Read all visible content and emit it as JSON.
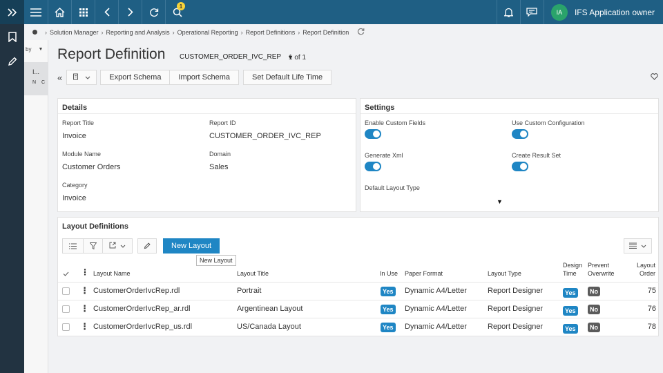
{
  "topbar": {
    "notification_count": "1",
    "user_initials": "IA",
    "user_name": "IFS Application owner",
    "icons": [
      "expand-icon",
      "menu-icon",
      "home-icon",
      "apps-icon",
      "back-icon",
      "forward-icon",
      "refresh-icon",
      "search-icon",
      "bell-icon",
      "chat-icon"
    ]
  },
  "breadcrumb": [
    "Solution Manager",
    "Reporting and Analysis",
    "Operational Reporting",
    "Report Definitions",
    "Report Definition"
  ],
  "list_panel": {
    "sort_label": "by",
    "item_line1": "I...",
    "item_line2": "N C"
  },
  "page": {
    "title": "Report Definition",
    "record_selector": "CUSTOMER_ORDER_IVC_REP",
    "record_count": "1 of 1"
  },
  "commands": {
    "export": "Export Schema",
    "import": "Import Schema",
    "default_life": "Set Default Life Time"
  },
  "details": {
    "title": "Details",
    "report_title_label": "Report Title",
    "report_title_value": "Invoice",
    "report_id_label": "Report ID",
    "report_id_value": "CUSTOMER_ORDER_IVC_REP",
    "module_label": "Module Name",
    "module_value": "Customer Orders",
    "domain_label": "Domain",
    "domain_value": "Sales",
    "category_label": "Category",
    "category_value": "Invoice"
  },
  "settings": {
    "title": "Settings",
    "custom_fields_label": "Enable Custom Fields",
    "custom_fields_on": true,
    "custom_config_label": "Use Custom Configuration",
    "custom_config_on": true,
    "gen_xml_label": "Generate Xml",
    "gen_xml_on": true,
    "result_set_label": "Create Result Set",
    "result_set_on": true,
    "default_layout_label": "Default Layout Type"
  },
  "layouts": {
    "title": "Layout Definitions",
    "new_layout": "New Layout",
    "tooltip": "New Layout",
    "columns": {
      "layout_name": "Layout Name",
      "layout_title": "Layout Title",
      "in_use": "In Use",
      "paper_format": "Paper Format",
      "layout_type": "Layout Type",
      "design_time_1": "Design",
      "design_time_2": "Time",
      "prevent_1": "Prevent",
      "prevent_2": "Overwrite",
      "order_1": "Layout",
      "order_2": "Order"
    },
    "rows": [
      {
        "name": "CustomerOrderIvcRep.rdl",
        "title": "Portrait",
        "in_use": "Yes",
        "paper": "Dynamic A4/Letter",
        "type": "Report Designer",
        "design": "Yes",
        "prevent": "No",
        "order": "75"
      },
      {
        "name": "CustomerOrderIvcRep_ar.rdl",
        "title": "Argentinean Layout",
        "in_use": "Yes",
        "paper": "Dynamic A4/Letter",
        "type": "Report Designer",
        "design": "Yes",
        "prevent": "No",
        "order": "76"
      },
      {
        "name": "CustomerOrderIvcRep_us.rdl",
        "title": "US/Canada Layout",
        "in_use": "Yes",
        "paper": "Dynamic A4/Letter",
        "type": "Report Designer",
        "design": "Yes",
        "prevent": "No",
        "order": "78"
      }
    ]
  },
  "colors": {
    "topbar": "#1f5f84",
    "rail": "#223341",
    "accent": "#1f86c4",
    "no_tag": "#5b5b5b",
    "avatar": "#2aa36b",
    "badge": "#f7d33a"
  }
}
